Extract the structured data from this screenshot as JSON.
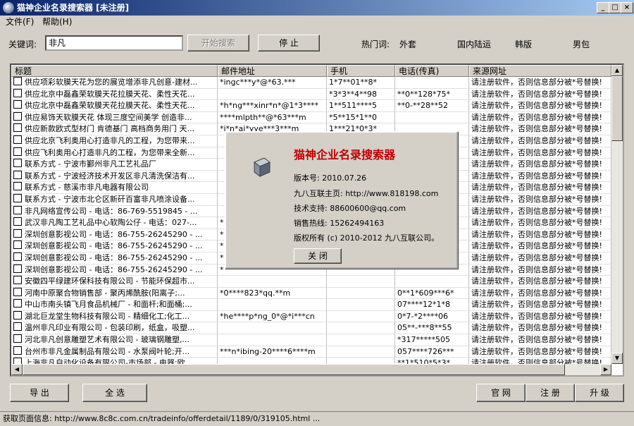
{
  "window": {
    "title": "猫神企业名录搜索器 [未注册]"
  },
  "menu": [
    "文件(F)",
    "帮助(H)"
  ],
  "search": {
    "keyword_label": "关键词:",
    "keyword_value": "非凡",
    "start_label": "开始搜索",
    "stop_label": "停  止",
    "hot_label": "热门词:",
    "hot_words": [
      "外套",
      "国内陆运",
      "韩版",
      "男包"
    ]
  },
  "table": {
    "columns": [
      "标题",
      "邮件地址",
      "手机",
      "电话(传真)",
      "来源网址"
    ],
    "rows": [
      [
        "供应项彩软膜天花为您的展览增添非凡创意-建材...",
        "*ingc***y*@*63.***",
        "1*7**01**8*",
        "",
        "请注册软件，否则信息部分被*号替换!"
      ],
      [
        "供应北京中磊鑫荣软膜天花拉膜天花、柔性天花...",
        "",
        "*3*3**4**98",
        "**0**128*75*",
        "请注册软件，否则信息部分被*号替换!"
      ],
      [
        "供应北京中磊鑫荣软膜天花拉膜天花、柔性天花...",
        "*h*ng***xinr*n*@1*3****",
        "1**511****5",
        "**0-**28**52",
        "请注册软件，否则信息部分被*号替换!"
      ],
      [
        "供应易饰天软膜天花 体现三度空间美学 创造非...",
        "****mlpth**@*63***m",
        "*5**15*1**0",
        "",
        "请注册软件，否则信息部分被*号替换!"
      ],
      [
        "供应新款欧式型材门 肯德基门 高档商务用门 天...",
        "*i*n*ai*yye***3***m",
        "1***21*0*3*",
        "",
        "请注册软件，否则信息部分被*号替换!"
      ],
      [
        "供应北京飞利奥用心打造非凡的工程，为您带来...",
        "",
        "",
        "",
        "请注册软件，否则信息部分被*号替换!"
      ],
      [
        "供应飞利奥用心打造非凡的工程，为您带来全新...",
        "",
        "",
        "",
        "请注册软件，否则信息部分被*号替换!"
      ],
      [
        "联系方式 - 宁波市鄞州非凡工艺礼品厂",
        "",
        "",
        "",
        "请注册软件，否则信息部分被*号替换!"
      ],
      [
        "联系方式 - 宁波经济技术开发区非凡清洗保洁有...",
        "",
        "",
        "",
        "请注册软件，否则信息部分被*号替换!"
      ],
      [
        "联系方式 - 慈溪市非凡电器有限公司",
        "",
        "",
        "",
        "请注册软件，否则信息部分被*号替换!"
      ],
      [
        "联系方式 - 宁波市北仑区新矸百富非凡喷涂设备...",
        "",
        "",
        "",
        "请注册软件，否则信息部分被*号替换!"
      ],
      [
        "非凡网络宣传公司 - 电话：86-769-5519845 - ...",
        "",
        "",
        "",
        "请注册软件，否则信息部分被*号替换!"
      ],
      [
        "武汉非凡陶工艺礼品中心软陶公仔 - 电话：027-...",
        "*",
        "",
        "",
        "请注册软件，否则信息部分被*号替换!"
      ],
      [
        "深圳创意影视公司 - 电话：86-755-26245290 - ...",
        "*",
        "",
        "",
        "请注册软件，否则信息部分被*号替换!"
      ],
      [
        "深圳创意影视公司 - 电话：86-755-26245290 - ...",
        "*",
        "",
        "",
        "请注册软件，否则信息部分被*号替换!"
      ],
      [
        "深圳创意影视公司 - 电话：86-755-26245290 - ...",
        "*",
        "",
        "",
        "请注册软件，否则信息部分被*号替换!"
      ],
      [
        "深圳创意影视公司 - 电话：86-755-26245290 - ...",
        "*",
        "",
        "",
        "请注册软件，否则信息部分被*号替换!"
      ],
      [
        "安徽四平绿建环保科技有限公司 - 节能环保超市...",
        "",
        "",
        "",
        "请注册软件，否则信息部分被*号替换!"
      ],
      [
        "河南中原聚合物销售部 - 聚丙烯酰胺(阳离子;...",
        "*0****823*qq.**m",
        "",
        "0**1*609***6*",
        "请注册软件，否则信息部分被*号替换!"
      ],
      [
        "中山市南头镇飞月食品机械厂 - 和面杆;和面桶;...",
        "",
        "",
        "07****12*1*8",
        "请注册软件，否则信息部分被*号替换!"
      ],
      [
        "湖北巨龙堂生物科技有限公司 - 精细化工;化工...",
        "*he****p*ng_0*@*i***cn",
        "",
        "0*7-*2****06",
        "请注册软件，否则信息部分被*号替换!"
      ],
      [
        "温州非凡印业有限公司 - 包装印刷，纸盒，吸塑...",
        "",
        "",
        "05**-***8**55",
        "请注册软件，否则信息部分被*号替换!"
      ],
      [
        "河北非凡创意雕塑艺术有限公司 - 玻璃钢雕塑,...",
        "",
        "",
        "*317*****505",
        "请注册软件，否则信息部分被*号替换!"
      ],
      [
        "台州市非凡金属制品有限公司 - 水泵阀叶轮;开...",
        "***n*ibing-20****6****m",
        "",
        "057****726***",
        "请注册软件，否则信息部分被*号替换!"
      ],
      [
        "上海非凡自动化设备有限公司-市场部 - 电器;欧...",
        "",
        "",
        "**1*510*5*3*",
        "请注册软件，否则信息部分被*号替换!"
      ]
    ]
  },
  "about": {
    "title": "猫神企业名录搜索器",
    "version": "版本号: 2010.07.26",
    "homepage": "九八互联主页: http://www.818198.com",
    "support": "技术支持: 88600600@qq.com",
    "hotline": "销售热线: 15262494163",
    "copyright": "版权所有 (c) 2010-2012 九八互联公司。",
    "close_label": "关  闭"
  },
  "buttons": {
    "export": "导  出",
    "select_all": "全  选",
    "website": "官  网",
    "register": "注  册",
    "upgrade": "升  级"
  },
  "status": {
    "text": "获取页面信息: http://www.8c8c.com.cn/tradeinfo/offerdetail/1189/0/319105.html ..."
  }
}
